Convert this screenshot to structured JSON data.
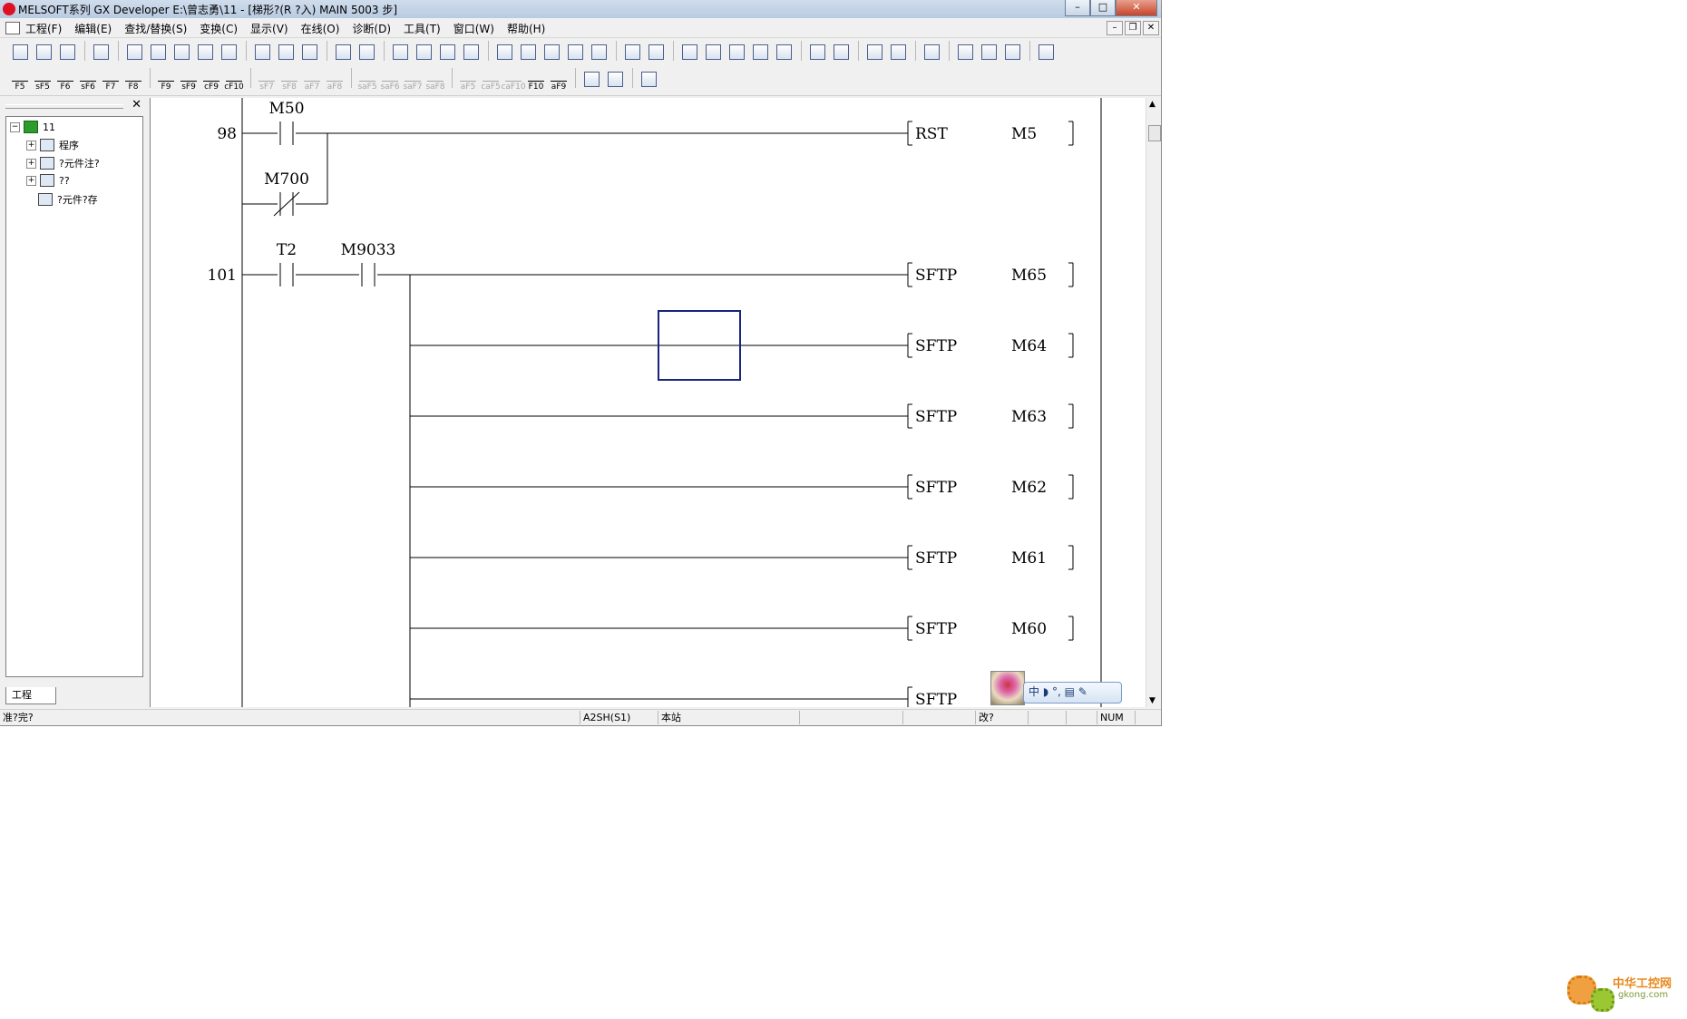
{
  "window": {
    "title": "MELSOFT系列 GX Developer E:\\曾志勇\\11 - [梯形?(R ?入)    MAIN    5003 步]",
    "controls": {
      "minimize": "–",
      "restore": "□",
      "close": "✕"
    },
    "mdi_controls": {
      "minimize": "–",
      "restore": "❐",
      "close": "✕"
    }
  },
  "menubar": {
    "items": [
      "工程(F)",
      "编辑(E)",
      "查找/替换(S)",
      "变换(C)",
      "显示(V)",
      "在线(O)",
      "诊断(D)",
      "工具(T)",
      "窗口(W)",
      "帮助(H)"
    ]
  },
  "ladder_toolbar": {
    "keys": [
      "F5",
      "sF5",
      "F6",
      "sF6",
      "F7",
      "F8",
      "F9",
      "sF9",
      "cF9",
      "cF10",
      "sF7",
      "sF8",
      "aF7",
      "aF8",
      "saF5",
      "saF6",
      "saF7",
      "saF8",
      "aF5",
      "caF5",
      "caF10",
      "F10",
      "aF9"
    ]
  },
  "project_tree": {
    "close": "✕",
    "root": "11",
    "children": [
      "程序",
      "?元件注?",
      "??",
      "?元件?存"
    ],
    "tab_label": "工程"
  },
  "ladder": {
    "rungs": [
      {
        "step": "98",
        "contacts": [
          {
            "device": "M50",
            "type": "NO"
          }
        ],
        "branch_contacts": [
          {
            "device": "M700",
            "type": "NC"
          }
        ],
        "outputs": [
          {
            "instr": "RST",
            "device": "M5"
          }
        ]
      },
      {
        "step": "101",
        "contacts": [
          {
            "device": "T2",
            "type": "NO"
          },
          {
            "device": "M9033",
            "type": "NO"
          }
        ],
        "outputs": [
          {
            "instr": "SFTP",
            "device": "M65"
          },
          {
            "instr": "SFTP",
            "device": "M64"
          },
          {
            "instr": "SFTP",
            "device": "M63"
          },
          {
            "instr": "SFTP",
            "device": "M62"
          },
          {
            "instr": "SFTP",
            "device": "M61"
          },
          {
            "instr": "SFTP",
            "device": "M60"
          },
          {
            "instr": "SFTP",
            "device": ""
          }
        ]
      }
    ]
  },
  "ime": {
    "text": "中 ◗ °, ▤ ✎"
  },
  "statusbar": {
    "ready": "准?完?",
    "cpu": "A2SH(S1)",
    "station": "本站",
    "mode": "改?",
    "num": "NUM"
  },
  "watermark": {
    "title": "中华工控网",
    "sub": "gkong.com"
  },
  "colors": {
    "cursor": "#1a237e",
    "ladder_line": "#000000",
    "title_bg": "#c4d3e6"
  }
}
